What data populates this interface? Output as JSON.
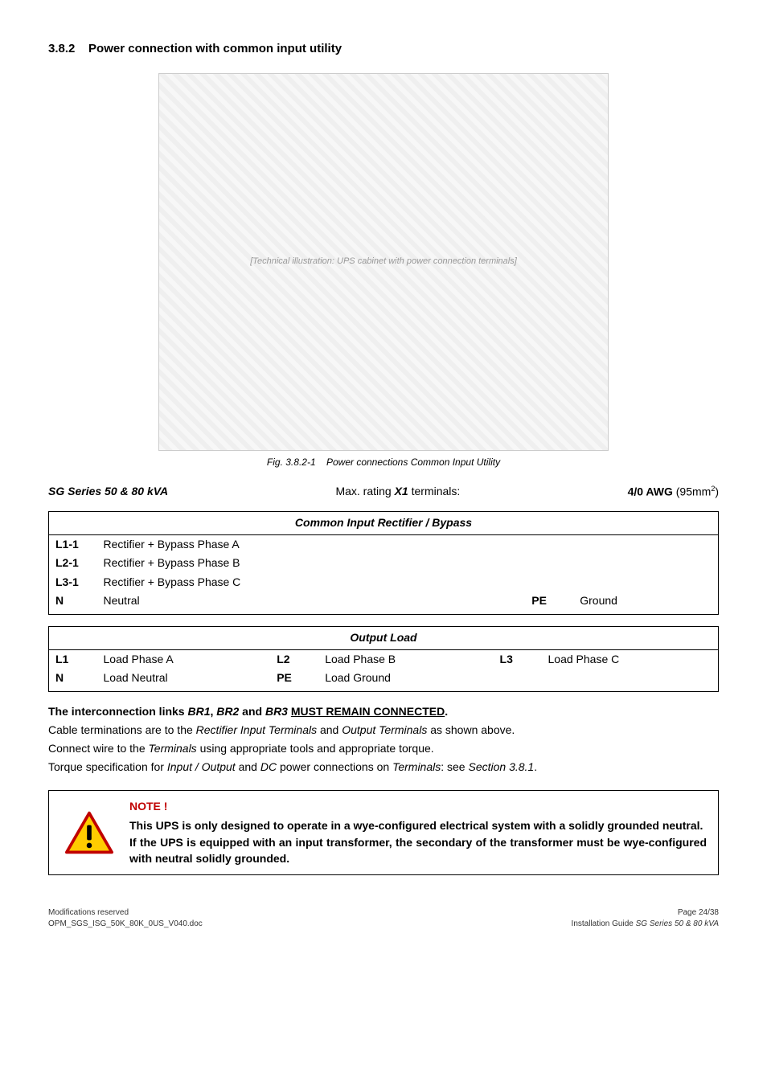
{
  "heading": {
    "number": "3.8.2",
    "title": "Power connection with common input utility"
  },
  "figure": {
    "placeholder": "[Technical illustration: UPS cabinet with power connection terminals]",
    "caption_prefix": "Fig. 3.8.2-1",
    "caption_text": "Power connections Common Input Utility"
  },
  "rating": {
    "left": "SG Series 50 & 80 kVA",
    "mid_pre": "Max. rating ",
    "mid_bold": "X1",
    "mid_post": " terminals:",
    "right_bold": "4/0 AWG",
    "right_unit_open": " (95mm",
    "right_sup": "2",
    "right_unit_close": ")"
  },
  "table1": {
    "title": "Common Input Rectifier / Bypass",
    "rows": [
      {
        "c1": "L1-1",
        "c2": "Rectifier + Bypass Phase A",
        "c3": "",
        "c4": ""
      },
      {
        "c1": "L2-1",
        "c2": "Rectifier + Bypass Phase B",
        "c3": "",
        "c4": ""
      },
      {
        "c1": "L3-1",
        "c2": "Rectifier + Bypass Phase C",
        "c3": "",
        "c4": ""
      },
      {
        "c1": "N",
        "c2": "Neutral",
        "c3": "PE",
        "c4": "Ground"
      }
    ]
  },
  "table2": {
    "title": "Output Load",
    "rows": [
      {
        "c1": "L1",
        "c2": "Load Phase A",
        "c3": "L2",
        "c4": "Load Phase B",
        "c5": "L3",
        "c6": "Load Phase C"
      },
      {
        "c1": "N",
        "c2": "Load Neutral",
        "c3": "PE",
        "c4": "Load Ground",
        "c5": "",
        "c6": ""
      }
    ]
  },
  "paragraphs": {
    "p1_pre": "The interconnection links ",
    "p1_b1": "BR1",
    "p1_sep1": ", ",
    "p1_b2": "BR2",
    "p1_sep2": " and ",
    "p1_b3": "BR3",
    "p1_sp": " ",
    "p1_u": "MUST REMAIN CONNECTED",
    "p1_end": ".",
    "p2_pre": "Cable terminations are to the ",
    "p2_i1": "Rectifier Input Terminals",
    "p2_mid": " and ",
    "p2_i2": "Output Terminals",
    "p2_end": " as shown above.",
    "p3_pre": "Connect wire to the ",
    "p3_i1": "Terminals",
    "p3_end": " using appropriate tools and appropriate torque.",
    "p4_pre": "Torque specification for ",
    "p4_i1": "Input / Output",
    "p4_mid1": " and ",
    "p4_i2": "DC",
    "p4_mid2": " power connections on ",
    "p4_i3": "Terminals",
    "p4_mid3": ": see ",
    "p4_i4": "Section 3.8.1",
    "p4_end": "."
  },
  "note": {
    "title": "NOTE !",
    "body1": "This UPS is only designed to operate in a wye-configured electrical system with a solidly grounded neutral.",
    "body2": "If the UPS is equipped with an input transformer, the secondary of the transformer must be wye-configured with neutral solidly grounded."
  },
  "footer": {
    "left1": "Modifications reserved",
    "left2": "OPM_SGS_ISG_50K_80K_0US_V040.doc",
    "right1": "Page 24/38",
    "right2_pre": "Installation Guide ",
    "right2_i": "SG Series 50 & 80 kVA"
  }
}
